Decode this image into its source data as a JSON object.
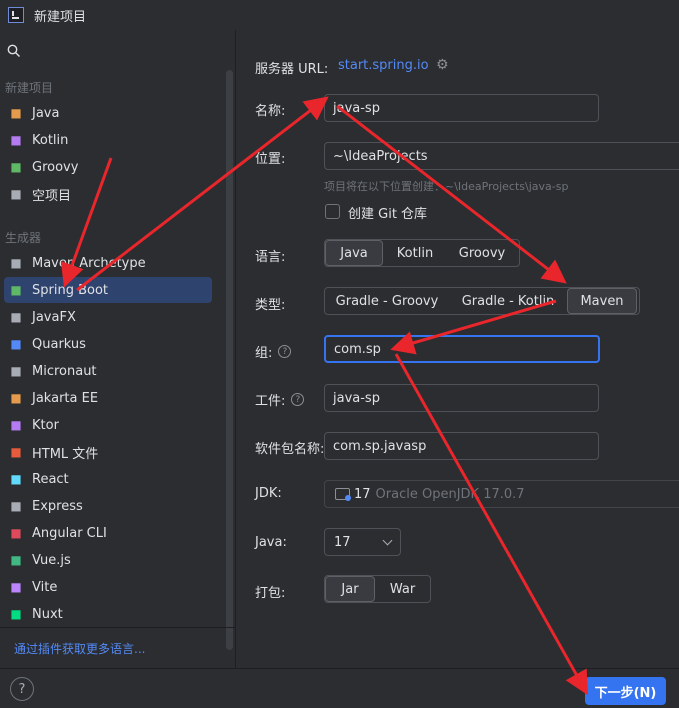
{
  "window": {
    "title": "新建项目"
  },
  "sidebar": {
    "new_project_label": "新建项目",
    "generators_label": "生成器",
    "more_link": "通过插件获取更多语言...",
    "projects": [
      {
        "label": "Java",
        "icon": "java-icon",
        "color": "#e49b4d"
      },
      {
        "label": "Kotlin",
        "icon": "kotlin-icon",
        "color": "#b47cf0"
      },
      {
        "label": "Groovy",
        "icon": "groovy-icon",
        "color": "#5fb865"
      },
      {
        "label": "空项目",
        "icon": "empty-project-icon",
        "color": "#a8adb5"
      }
    ],
    "generators": [
      {
        "label": "Maven Archetype",
        "icon": "maven-icon",
        "color": "#a8adb5"
      },
      {
        "label": "Spring Boot",
        "icon": "spring-boot-icon",
        "color": "#5fb865",
        "selected": true
      },
      {
        "label": "JavaFX",
        "icon": "javafx-icon",
        "color": "#a8adb5"
      },
      {
        "label": "Quarkus",
        "icon": "quarkus-icon",
        "color": "#548af7"
      },
      {
        "label": "Micronaut",
        "icon": "micronaut-icon",
        "color": "#a8adb5"
      },
      {
        "label": "Jakarta EE",
        "icon": "jakarta-ee-icon",
        "color": "#e49b4d"
      },
      {
        "label": "Ktor",
        "icon": "ktor-icon",
        "color": "#b47cf0"
      },
      {
        "label": "HTML 文件",
        "icon": "html-icon",
        "color": "#e55b3c"
      },
      {
        "label": "React",
        "icon": "react-icon",
        "color": "#61dafb"
      },
      {
        "label": "Express",
        "icon": "express-icon",
        "color": "#a8adb5"
      },
      {
        "label": "Angular CLI",
        "icon": "angular-icon",
        "color": "#dd4a5c"
      },
      {
        "label": "Vue.js",
        "icon": "vue-icon",
        "color": "#41b883"
      },
      {
        "label": "Vite",
        "icon": "vite-icon",
        "color": "#bd85fc"
      },
      {
        "label": "Nuxt",
        "icon": "nuxt-icon",
        "color": "#00dc82"
      }
    ]
  },
  "form": {
    "server_url_label": "服务器 URL:",
    "server_url_value": "start.spring.io",
    "name_label": "名称:",
    "name_value": "java-sp",
    "location_label": "位置:",
    "location_value": "~\\IdeaProjects",
    "location_hint": "项目将在以下位置创建：~\\IdeaProjects\\java-sp",
    "git_label": "创建 Git 仓库",
    "language_label": "语言:",
    "languages": [
      "Java",
      "Kotlin",
      "Groovy"
    ],
    "language_selected": "Java",
    "type_label": "类型:",
    "types": [
      "Gradle - Groovy",
      "Gradle - Kotlin",
      "Maven"
    ],
    "type_selected": "Maven",
    "group_label": "组:",
    "group_value": "com.sp",
    "artifact_label": "工件:",
    "artifact_value": "java-sp",
    "package_label": "软件包名称:",
    "package_value": "com.sp.javasp",
    "jdk_label": "JDK:",
    "jdk_version": "17",
    "jdk_name": "Oracle OpenJDK 17.0.7",
    "java_label": "Java:",
    "java_value": "17",
    "packaging_label": "打包:",
    "packaging": [
      "Jar",
      "War"
    ],
    "packaging_selected": "Jar"
  },
  "footer": {
    "help_label": "?",
    "next_label": "下一步(N)"
  },
  "colors": {
    "accent": "#3574f0",
    "link": "#548af7",
    "annotation": "#e8262b"
  }
}
